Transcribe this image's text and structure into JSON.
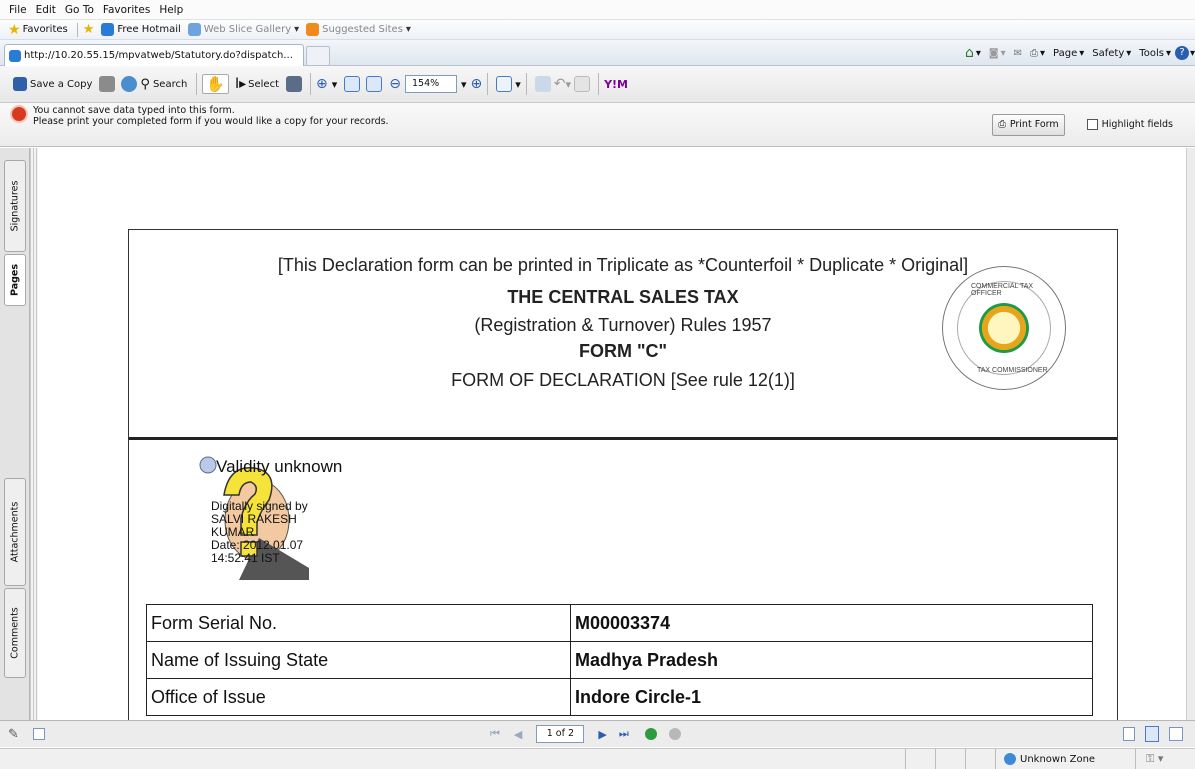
{
  "menu": {
    "items": [
      "File",
      "Edit",
      "Go To",
      "Favorites",
      "Help"
    ]
  },
  "favorites": {
    "label": "Favorites",
    "links": [
      "Free Hotmail",
      "Web Slice Gallery",
      "Suggested Sites"
    ]
  },
  "tab": {
    "url": "http://10.20.55.15/mpvatweb/Statutory.do?dispatch..."
  },
  "command_bar": {
    "page": "Page",
    "safety": "Safety",
    "tools": "Tools"
  },
  "acrobat": {
    "save_copy": "Save a Copy",
    "search": "Search",
    "select": "Select",
    "zoom": "154%"
  },
  "message": {
    "line1": "You cannot save data typed into this form.",
    "line2": "Please print your completed form if you would like a copy for your records.",
    "print_button": "Print Form",
    "highlight_label": "Highlight fields"
  },
  "side_tabs": {
    "signatures": "Signatures",
    "pages": "Pages",
    "attachments": "Attachments",
    "comments": "Comments"
  },
  "document": {
    "note": "[This Declaration form can be printed in Triplicate as *Counterfoil * Duplicate * Original]",
    "title": "THE CENTRAL SALES TAX",
    "subtitle": "(Registration & Turnover) Rules 1957",
    "form": "FORM \"C\"",
    "declaration": "FORM OF DECLARATION [See rule 12(1)]",
    "seal_top": "COMMERCIAL TAX OFFICER",
    "seal_bottom": "TAX COMMISSIONER",
    "signature": {
      "validity": "Validity unknown",
      "lines": [
        "Digitally signed by",
        "SALVI RAKESH",
        "KUMAR",
        "Date: 2012.01.07",
        "14:52:41 IST"
      ]
    },
    "rows": [
      {
        "label": "Form Serial No.",
        "value": "M00003374"
      },
      {
        "label": "Name of Issuing State",
        "value": "Madhya Pradesh"
      },
      {
        "label": "Office of Issue",
        "value": "Indore Circle-1"
      }
    ]
  },
  "navigation": {
    "page_indicator": "1 of 2"
  },
  "status": {
    "zone": "Unknown Zone"
  },
  "colors": {
    "accent": "#2a5db0",
    "seal_green": "#1d9b46",
    "seal_red": "#e02020"
  }
}
